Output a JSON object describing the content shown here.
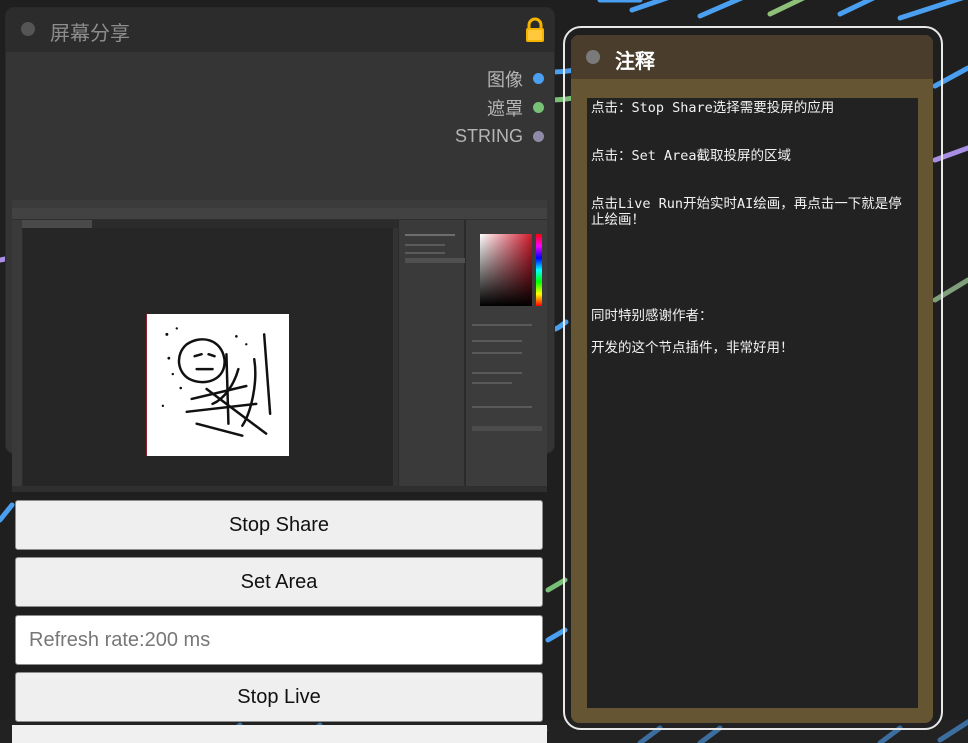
{
  "share_node": {
    "title": "屏幕分享",
    "outputs": [
      {
        "label": "图像",
        "color": "#4a9ff0"
      },
      {
        "label": "遮罩",
        "color": "#78c076"
      },
      {
        "label": "STRING",
        "color": "#8e8aa8"
      }
    ],
    "lock_icon": "lock-icon",
    "buttons": {
      "stop_share": "Stop Share",
      "set_area": "Set Area",
      "stop_live": "Stop Live"
    },
    "refresh_rate_placeholder": "Refresh rate:200 ms"
  },
  "note_node": {
    "title": "注释",
    "lines": [
      "点击：Stop Share选择需要投屏的应用",
      "点击：Set Area截取投屏的区域",
      "点击Live Run开始实时AI绘画，再点击一下就是停止绘画！",
      "同时特别感谢作者：",
      "开发的这个节点插件，非常好用！"
    ]
  },
  "colors": {
    "node_bg": "#353535",
    "note_bg": "#665533",
    "note_title_bg": "#4a3d2c"
  }
}
